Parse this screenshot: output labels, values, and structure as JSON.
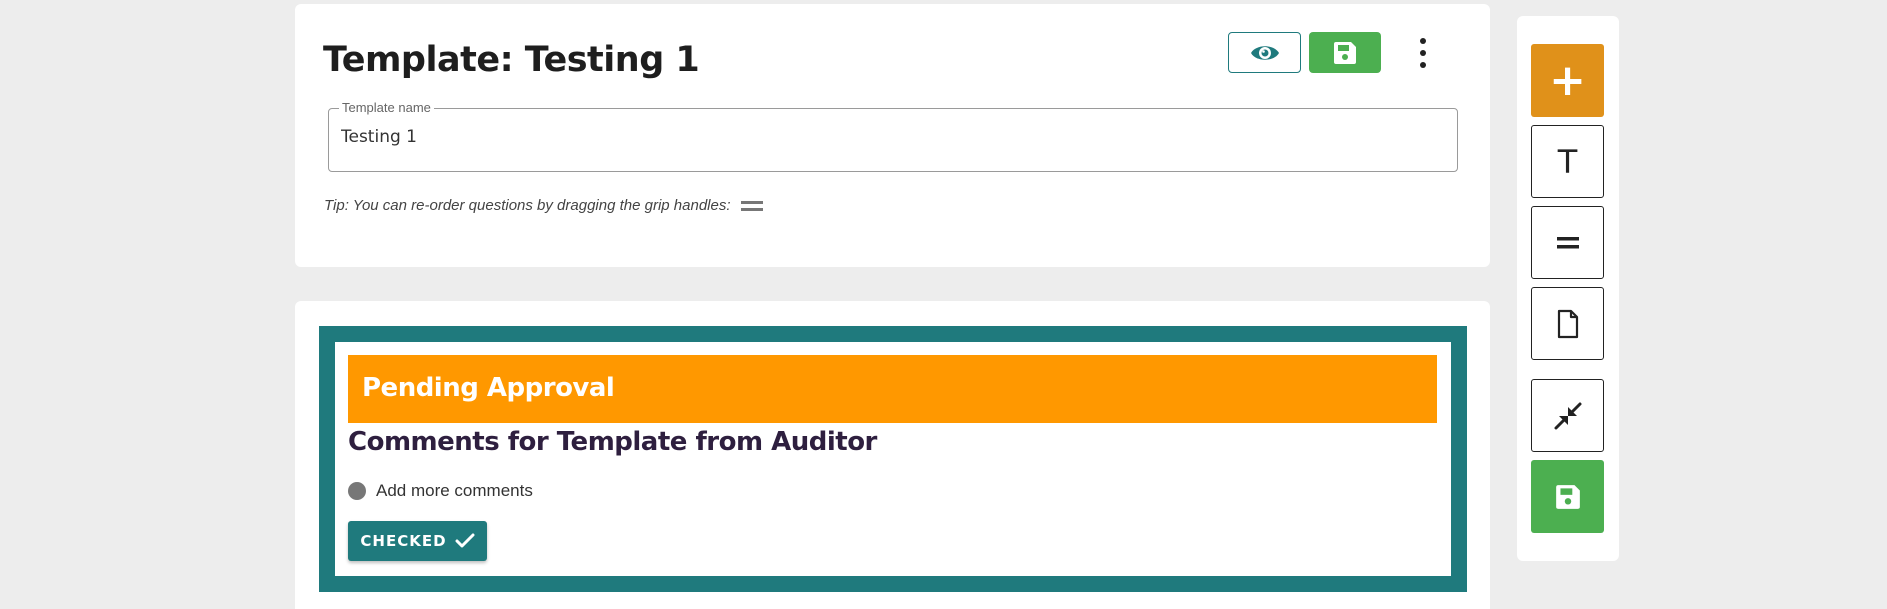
{
  "header": {
    "title": "Template: Testing 1"
  },
  "template_name_field": {
    "label": "Template name",
    "value": "Testing 1"
  },
  "tip": {
    "text": "Tip: You can re-order questions by dragging the grip handles:"
  },
  "section": {
    "status_banner": "Pending Approval",
    "title": "Comments for Template from Auditor",
    "option_label": "Add more comments",
    "checked_button_label": "CHECKED"
  },
  "toolbox": {
    "add_symbol": "+",
    "text_symbol": "T"
  },
  "colors": {
    "teal": "#1f7a7d",
    "green": "#4caf50",
    "orange": "#ff9800",
    "add_orange": "#e0911a"
  },
  "icons": [
    "eye-icon",
    "floppy-disk-icon",
    "more-vertical-icon",
    "grip-icon",
    "check-icon",
    "plus-icon",
    "text-icon",
    "equals-icon",
    "document-icon",
    "collapse-icon"
  ]
}
